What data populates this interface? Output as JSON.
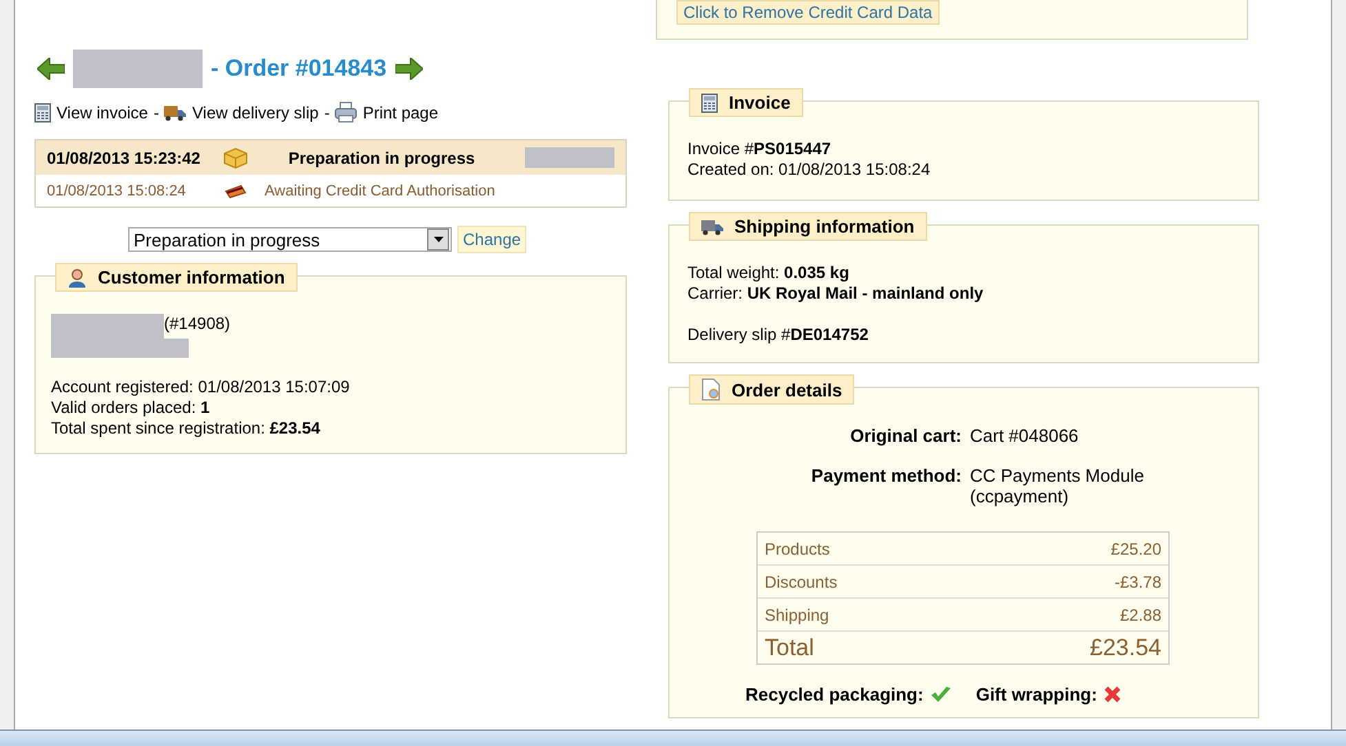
{
  "top_box": {
    "button": "Click to Remove Credit Card Data"
  },
  "title": {
    "separator": "- Order #014843"
  },
  "actions": [
    {
      "kind": "invoice",
      "label": "View invoice",
      "sep": "-"
    },
    {
      "kind": "delivery",
      "label": "View delivery slip",
      "sep": "-"
    },
    {
      "kind": "print",
      "label": "Print page"
    }
  ],
  "history": [
    {
      "date": "01/08/2013 15:23:42",
      "kind": "box",
      "status": "Preparation in progress",
      "selected": true
    },
    {
      "date": "01/08/2013 15:08:24",
      "kind": "card",
      "status": "Awaiting Credit Card Authorisation",
      "selected": false
    }
  ],
  "status_select": {
    "value": "Preparation in progress",
    "button": "Change"
  },
  "customer": {
    "title": "Customer information",
    "id": "(#14908)",
    "lines": [
      "Account registered: 01/08/2013 15:07:09",
      "Valid orders placed: **1**",
      "Total spent since registration: **£23.54**"
    ]
  },
  "invoice": {
    "title": "Invoice",
    "lines": [
      "Invoice #**PS015447**",
      "Created on: 01/08/2013 15:08:24"
    ]
  },
  "shipping": {
    "title": "Shipping information",
    "lines": [
      "Total weight: **0.035 kg**",
      "Carrier: **UK Royal Mail - mainland only**"
    ],
    "slip": "Delivery slip #**DE014752**"
  },
  "order_details": {
    "title": "Order details",
    "fields": [
      {
        "label": "Original cart:",
        "value": "Cart #048066"
      },
      {
        "label": "Payment method:",
        "value": "CC Payments Module (ccpayment)"
      }
    ],
    "totals": [
      {
        "label": "Products",
        "value": "£25.20",
        "kind": "line"
      },
      {
        "label": "Discounts",
        "value": "-£3.78",
        "kind": "line"
      },
      {
        "label": "Shipping",
        "value": "£2.88",
        "kind": "line"
      },
      {
        "label": "Total",
        "value": "£23.54",
        "kind": "total"
      }
    ],
    "flags": [
      {
        "label": "Recycled packaging:",
        "on": true
      },
      {
        "label": "Gift wrapping:",
        "on": false
      }
    ]
  }
}
